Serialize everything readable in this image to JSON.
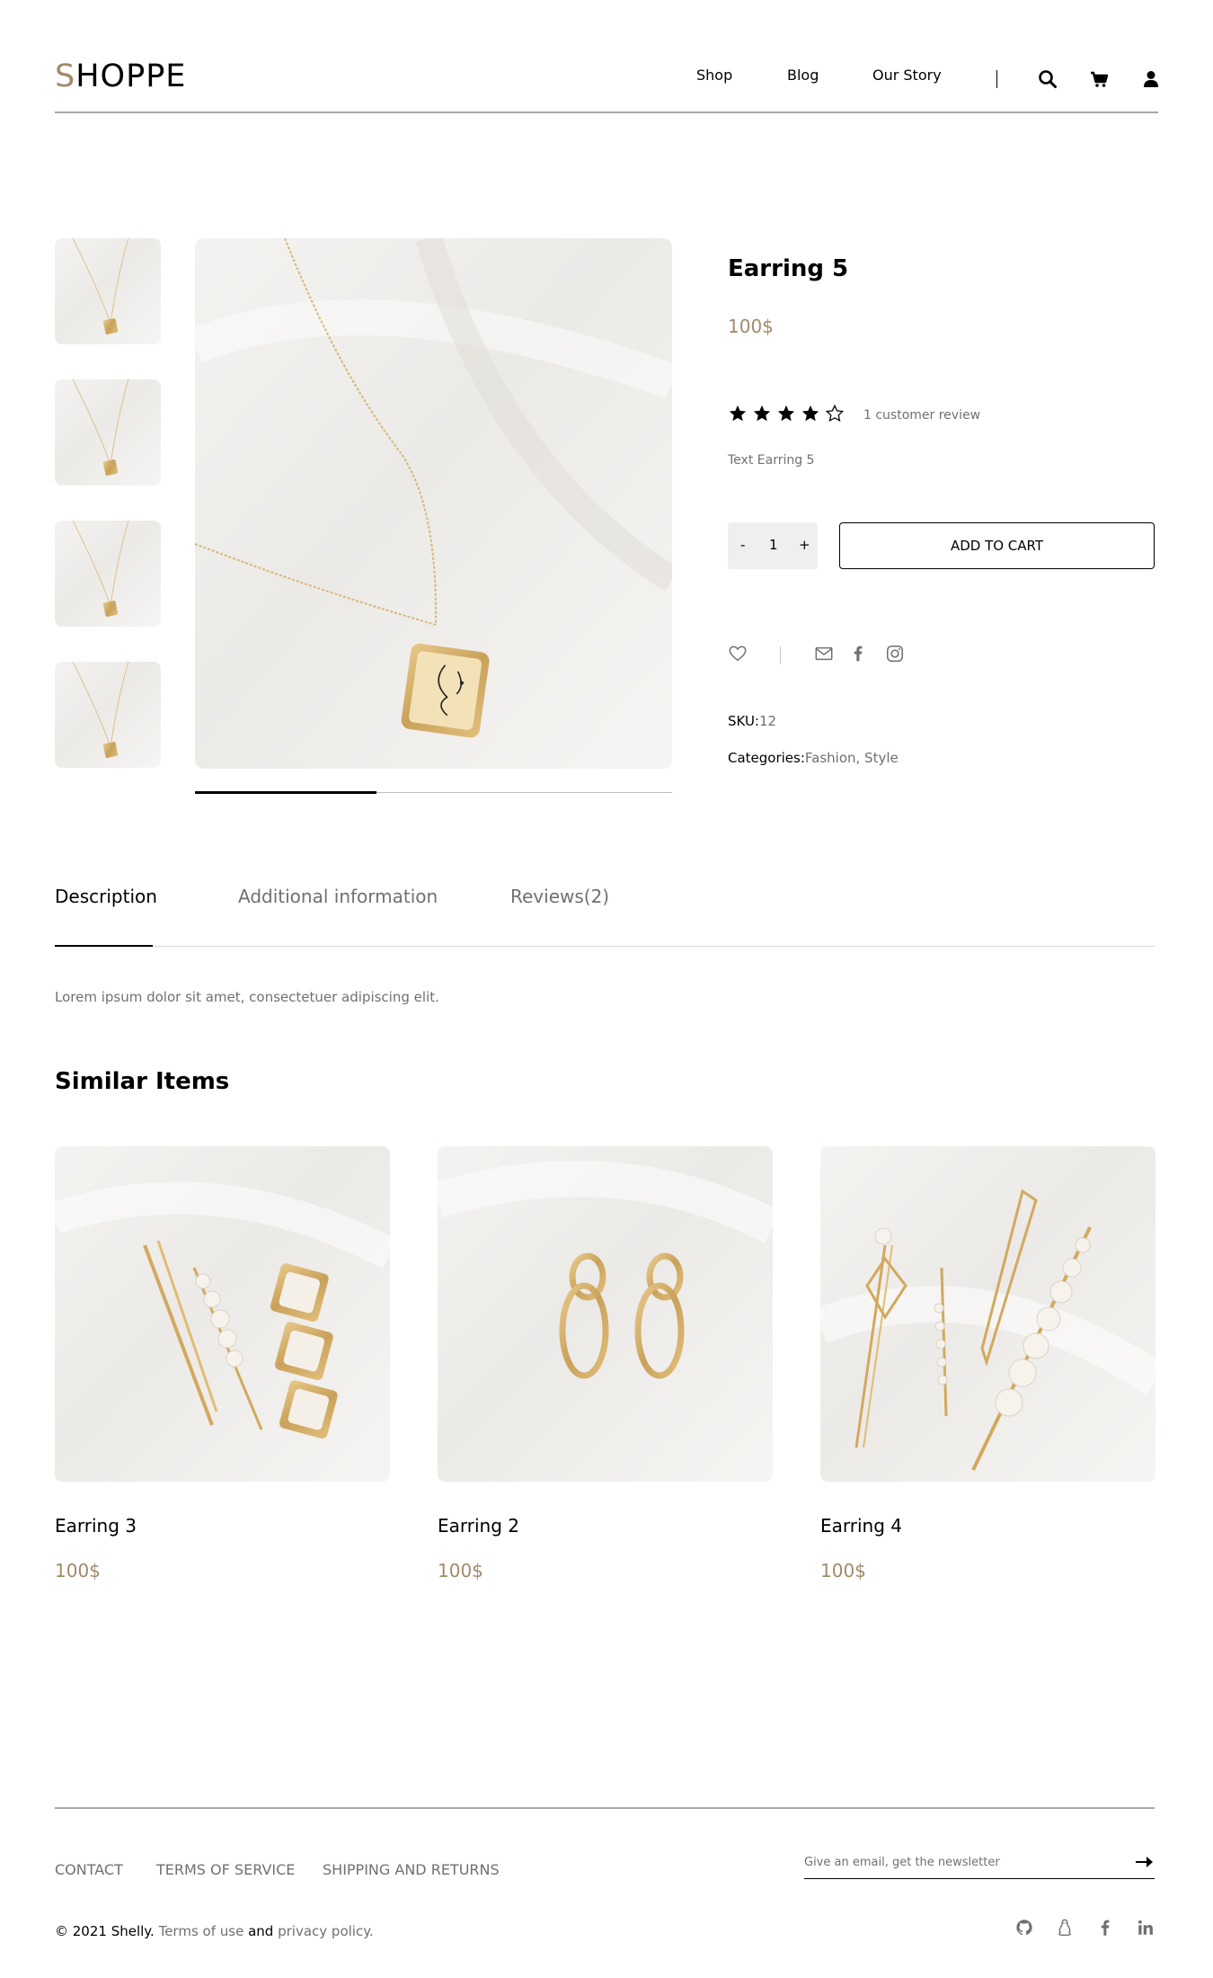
{
  "header": {
    "logo_first": "S",
    "logo_rest": "HOPPE",
    "nav": [
      "Shop",
      "Blog",
      "Our Story"
    ],
    "icons": [
      "search-icon",
      "cart-icon",
      "user-icon"
    ]
  },
  "product": {
    "title": "Earring 5",
    "price": "100$",
    "rating": 4,
    "rating_max": 5,
    "review_count": "1 customer review",
    "short_description": "Text Earring 5",
    "quantity": "1",
    "qty_minus": "-",
    "qty_plus": "+",
    "add_to_cart": "ADD TO CART",
    "sku_label": "SKU:",
    "sku_value": "12",
    "categories_label": "Categories:",
    "categories_value": "Fashion, Style",
    "thumbnail_count": 4
  },
  "tabs": {
    "items": [
      "Description",
      "Additional information",
      "Reviews(2)"
    ],
    "active": "Description",
    "content": "Lorem ipsum dolor sit amet, consectetuer adipiscing elit."
  },
  "similar": {
    "title": "Similar Items",
    "items": [
      {
        "name": "Earring 3",
        "price": "100$"
      },
      {
        "name": "Earring 2",
        "price": "100$"
      },
      {
        "name": "Earring 4",
        "price": "100$"
      }
    ]
  },
  "footer": {
    "links": [
      "CONTACT",
      "TERMS OF SERVICE",
      "SHIPPING AND RETURNS"
    ],
    "newsletter_placeholder": "Give an email, get the newsletter",
    "copyright_prefix": "© 2021 Shelly.",
    "terms_link": "Terms of use",
    "and_text": "and",
    "privacy_link": "privacy policy.",
    "social": [
      "github-icon",
      "linux-icon",
      "facebook-icon",
      "linkedin-icon"
    ]
  },
  "colors": {
    "accent": "#a18a68",
    "muted": "#707070",
    "divider": "#a8a8a8"
  }
}
